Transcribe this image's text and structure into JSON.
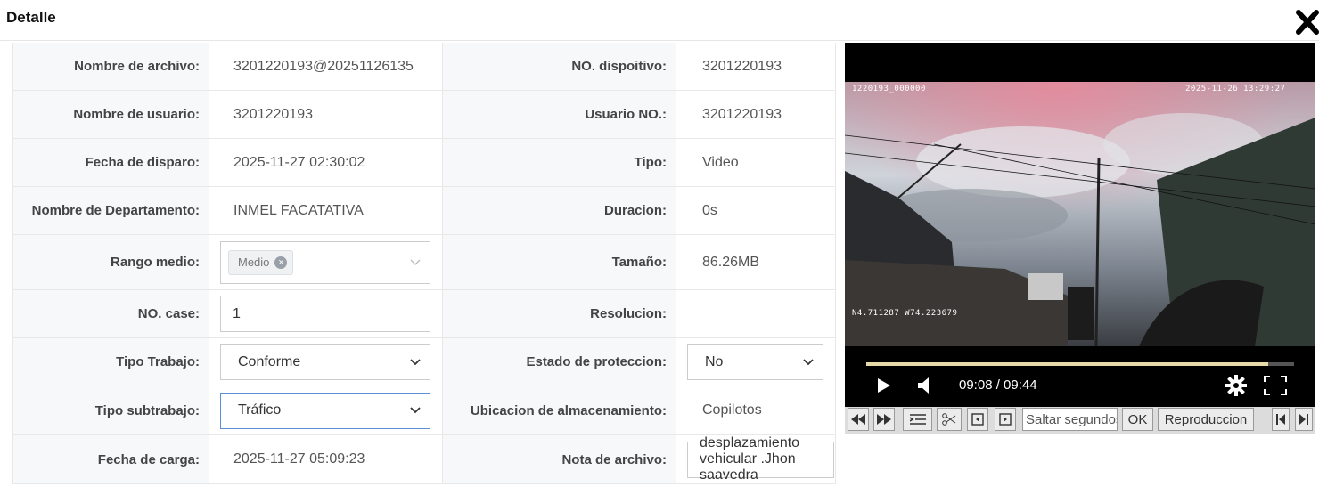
{
  "dialog": {
    "title": "Detalle"
  },
  "icons": {
    "close": "close-icon",
    "play": "play-icon",
    "volume": "volume-icon",
    "settings": "gear-icon",
    "fullscreen": "fullscreen-icon"
  },
  "colors": {
    "tag_bg": "#f0f1f3",
    "label_bg": "#f7f8fa",
    "focus_border": "#5b8fd6"
  },
  "rows": {
    "file_name": {
      "label": "Nombre de archivo:",
      "value": "3201220193@20251126135"
    },
    "device_no": {
      "label": "NO. dispoitivo:",
      "value": "3201220193"
    },
    "user_name": {
      "label": "Nombre de usuario:",
      "value": "3201220193"
    },
    "user_no": {
      "label": "Usuario NO.:",
      "value": "3201220193"
    },
    "trigger_date": {
      "label": "Fecha de disparo:",
      "value": "2025-11-27 02:30:02"
    },
    "type": {
      "label": "Tipo:",
      "value": "Video"
    },
    "department": {
      "label": "Nombre de Departamento:",
      "value": "INMEL FACATATIVA"
    },
    "duration": {
      "label": "Duracion:",
      "value": "0s"
    },
    "media_range": {
      "label": "Rango medio:",
      "tag": "Medio"
    },
    "size": {
      "label": "Tamaño:",
      "value": "86.26MB"
    },
    "case_no": {
      "label": "NO. case:",
      "value": "1"
    },
    "resolution": {
      "label": "Resolucion:",
      "value": ""
    },
    "work_type": {
      "label": "Tipo Trabajo:",
      "value": "Conforme"
    },
    "protection": {
      "label": "Estado de proteccion:",
      "value": "No"
    },
    "sub_work_type": {
      "label": "Tipo subtrabajo:",
      "value": "Tráfico"
    },
    "storage": {
      "label": "Ubicacion de almacenamiento:",
      "value": "Copilotos"
    },
    "upload_date": {
      "label": "Fecha de carga:",
      "value": "2025-11-27 05:09:23"
    },
    "file_note": {
      "label": "Nota de archivo:",
      "value": "desplazamiento vehicular .Jhon saavedra"
    }
  },
  "video": {
    "overlay_id": "1220193_000000",
    "overlay_datetime": "2025-11-26 13:29:27",
    "overlay_gps": "N4.711287 W74.223679",
    "time": "09:08 / 09:44",
    "progress": 0.94
  },
  "toolbar": {
    "jump_placeholder": "Saltar segundos",
    "ok": "OK",
    "playback": "Reproduccion"
  }
}
